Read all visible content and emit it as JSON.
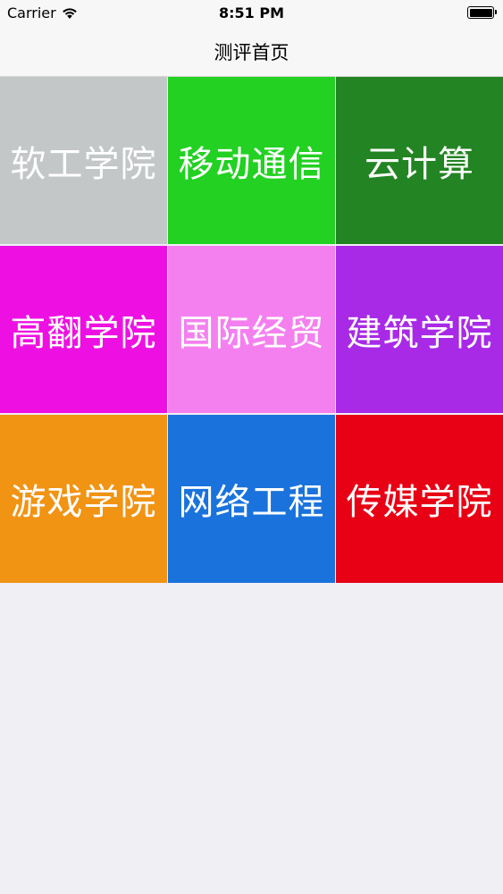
{
  "status_bar": {
    "carrier": "Carrier",
    "time": "8:51 PM",
    "wifi_icon": "wifi-icon",
    "battery_icon": "battery-full-icon"
  },
  "nav_bar": {
    "title": "测评首页"
  },
  "tiles": [
    {
      "label": "软工学院",
      "color": "#c4c7c8"
    },
    {
      "label": "移动通信",
      "color": "#22d122"
    },
    {
      "label": "云计算",
      "color": "#228422"
    },
    {
      "label": "高翻学院",
      "color": "#ee10e2"
    },
    {
      "label": "国际经贸",
      "color": "#f480f0"
    },
    {
      "label": "建筑学院",
      "color": "#a82ae6"
    },
    {
      "label": "游戏学院",
      "color": "#f19313"
    },
    {
      "label": "网络工程",
      "color": "#1a73dc"
    },
    {
      "label": "传媒学院",
      "color": "#e80014"
    }
  ]
}
